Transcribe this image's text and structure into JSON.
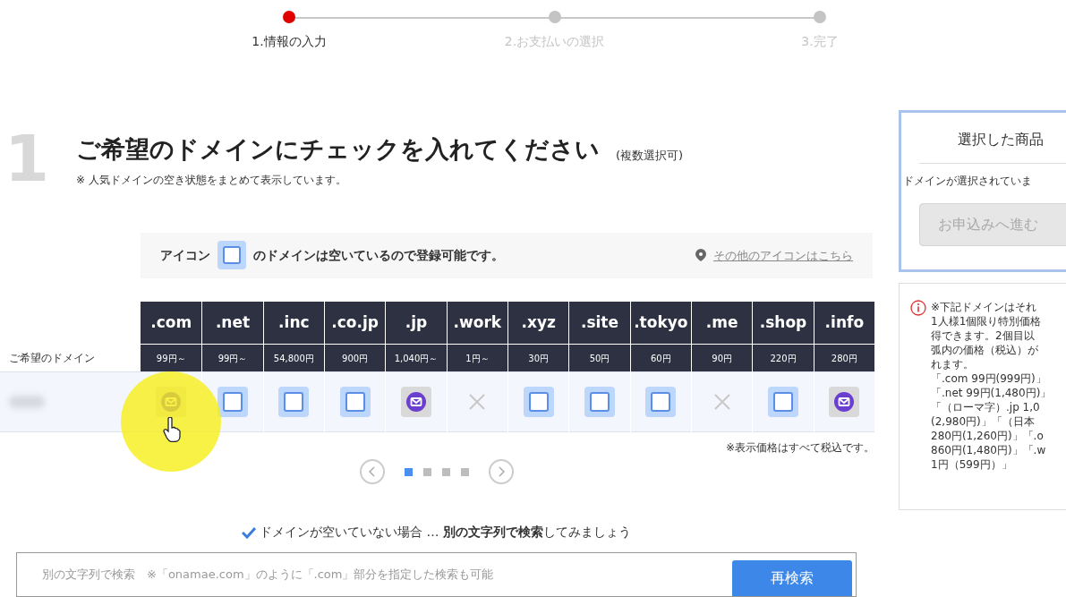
{
  "steps": [
    {
      "label": "1.情報の入力",
      "selected": true
    },
    {
      "label": "2.お支払いの選択",
      "selected": false
    },
    {
      "label": "3.完了",
      "selected": false
    }
  ],
  "section": {
    "number": "1",
    "title": "ご希望のドメインにチェックを入れてください",
    "title_note": "(複数選択可)",
    "subtitle": "※ 人気ドメインの空き状態をまとめて表示しています。"
  },
  "legend": {
    "before": "アイコン",
    "after": "のドメインは空いているので登録可能です。",
    "link": "その他のアイコンはこちら"
  },
  "table": {
    "row_label": "ご希望のドメイン",
    "columns": [
      {
        "tld": ".com",
        "price": "99円～",
        "kind": "mail"
      },
      {
        "tld": ".net",
        "price": "99円～",
        "kind": "available"
      },
      {
        "tld": ".inc",
        "price": "54,800円",
        "kind": "available"
      },
      {
        "tld": ".co.jp",
        "price": "900円",
        "kind": "available"
      },
      {
        "tld": ".jp",
        "price": "1,040円～",
        "kind": "mail"
      },
      {
        "tld": ".work",
        "price": "1円～",
        "kind": "taken"
      },
      {
        "tld": ".xyz",
        "price": "30円",
        "kind": "available"
      },
      {
        "tld": ".site",
        "price": "50円",
        "kind": "available"
      },
      {
        "tld": ".tokyo",
        "price": "60円",
        "kind": "available"
      },
      {
        "tld": ".me",
        "price": "90円",
        "kind": "taken"
      },
      {
        "tld": ".shop",
        "price": "220円",
        "kind": "available"
      },
      {
        "tld": ".info",
        "price": "280円",
        "kind": "mail"
      }
    ],
    "tax_note": "※表示価格はすべて税込です。"
  },
  "pager": [
    {
      "selected": true
    },
    {
      "selected": false
    },
    {
      "selected": false
    },
    {
      "selected": false
    }
  ],
  "hint": {
    "text": "ドメインが空いていない場合 … **別の文字列で検索**してみましょう"
  },
  "search": {
    "placeholder": "別の文字列で検索　※「onamae.com」のように「.com」部分を指定した検索も可能",
    "button": "再検索"
  },
  "cart": {
    "title": "選択した商品",
    "empty": "ドメインが選択されていま",
    "button": "お申込みへ進む"
  },
  "notice": {
    "lines": [
      "※下記ドメインはそれ",
      "1人様1個限り特別価格",
      "得できます。2個目以",
      "弧内の価格（税込）が",
      "れます。",
      "「.com 99円(999円)」",
      "「.net 99円(1,480円)」",
      "「（ローマ字）.jp 1,0",
      "(2,980円)」「（日本",
      "280円(1,260円)」「.o",
      "860円(1,480円)」「.w",
      "1円（599円）」"
    ]
  }
}
